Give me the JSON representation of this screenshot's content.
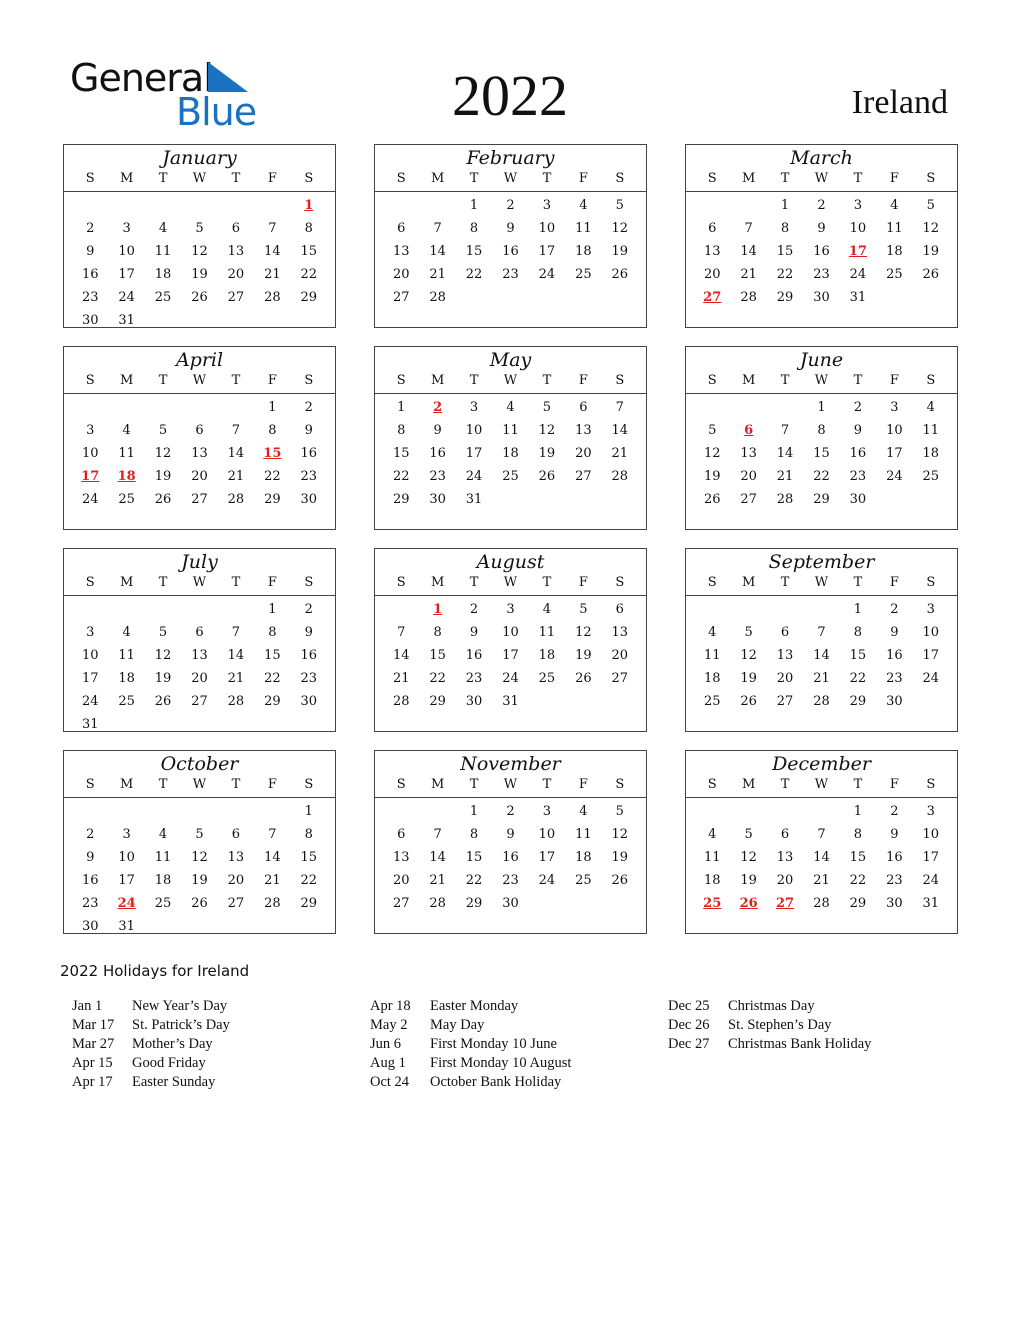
{
  "header": {
    "logo_top": "General",
    "logo_bottom": "Blue",
    "year": "2022",
    "country": "Ireland"
  },
  "weekdays": [
    "S",
    "M",
    "T",
    "W",
    "T",
    "F",
    "S"
  ],
  "months": [
    {
      "name": "January",
      "start": 6,
      "days": 31,
      "holidays": [
        1
      ]
    },
    {
      "name": "February",
      "start": 2,
      "days": 28,
      "holidays": []
    },
    {
      "name": "March",
      "start": 2,
      "days": 31,
      "holidays": [
        17,
        27
      ]
    },
    {
      "name": "April",
      "start": 5,
      "days": 30,
      "holidays": [
        15,
        17,
        18
      ]
    },
    {
      "name": "May",
      "start": 0,
      "days": 31,
      "holidays": [
        2
      ]
    },
    {
      "name": "June",
      "start": 3,
      "days": 30,
      "holidays": [
        6
      ]
    },
    {
      "name": "July",
      "start": 5,
      "days": 31,
      "holidays": []
    },
    {
      "name": "August",
      "start": 1,
      "days": 31,
      "holidays": [
        1
      ]
    },
    {
      "name": "September",
      "start": 4,
      "days": 30,
      "holidays": []
    },
    {
      "name": "October",
      "start": 6,
      "days": 31,
      "holidays": [
        24
      ]
    },
    {
      "name": "November",
      "start": 2,
      "days": 30,
      "holidays": []
    },
    {
      "name": "December",
      "start": 4,
      "days": 31,
      "holidays": [
        25,
        26,
        27
      ]
    }
  ],
  "holidays_title": "2022 Holidays for Ireland",
  "holiday_columns": [
    [
      {
        "date": "Jan 1",
        "name": "New Year’s Day"
      },
      {
        "date": "Mar 17",
        "name": "St. Patrick’s Day"
      },
      {
        "date": "Mar 27",
        "name": "Mother’s Day"
      },
      {
        "date": "Apr 15",
        "name": "Good Friday"
      },
      {
        "date": "Apr 17",
        "name": "Easter Sunday"
      }
    ],
    [
      {
        "date": "Apr 18",
        "name": "Easter Monday"
      },
      {
        "date": "May 2",
        "name": "May Day"
      },
      {
        "date": "Jun 6",
        "name": "First Monday 10 June"
      },
      {
        "date": "Aug 1",
        "name": "First Monday 10 August"
      },
      {
        "date": "Oct 24",
        "name": "October Bank Holiday"
      }
    ],
    [
      {
        "date": "Dec 25",
        "name": "Christmas Day"
      },
      {
        "date": "Dec 26",
        "name": "St. Stephen’s Day"
      },
      {
        "date": "Dec 27",
        "name": "Christmas Bank Holiday"
      }
    ]
  ]
}
